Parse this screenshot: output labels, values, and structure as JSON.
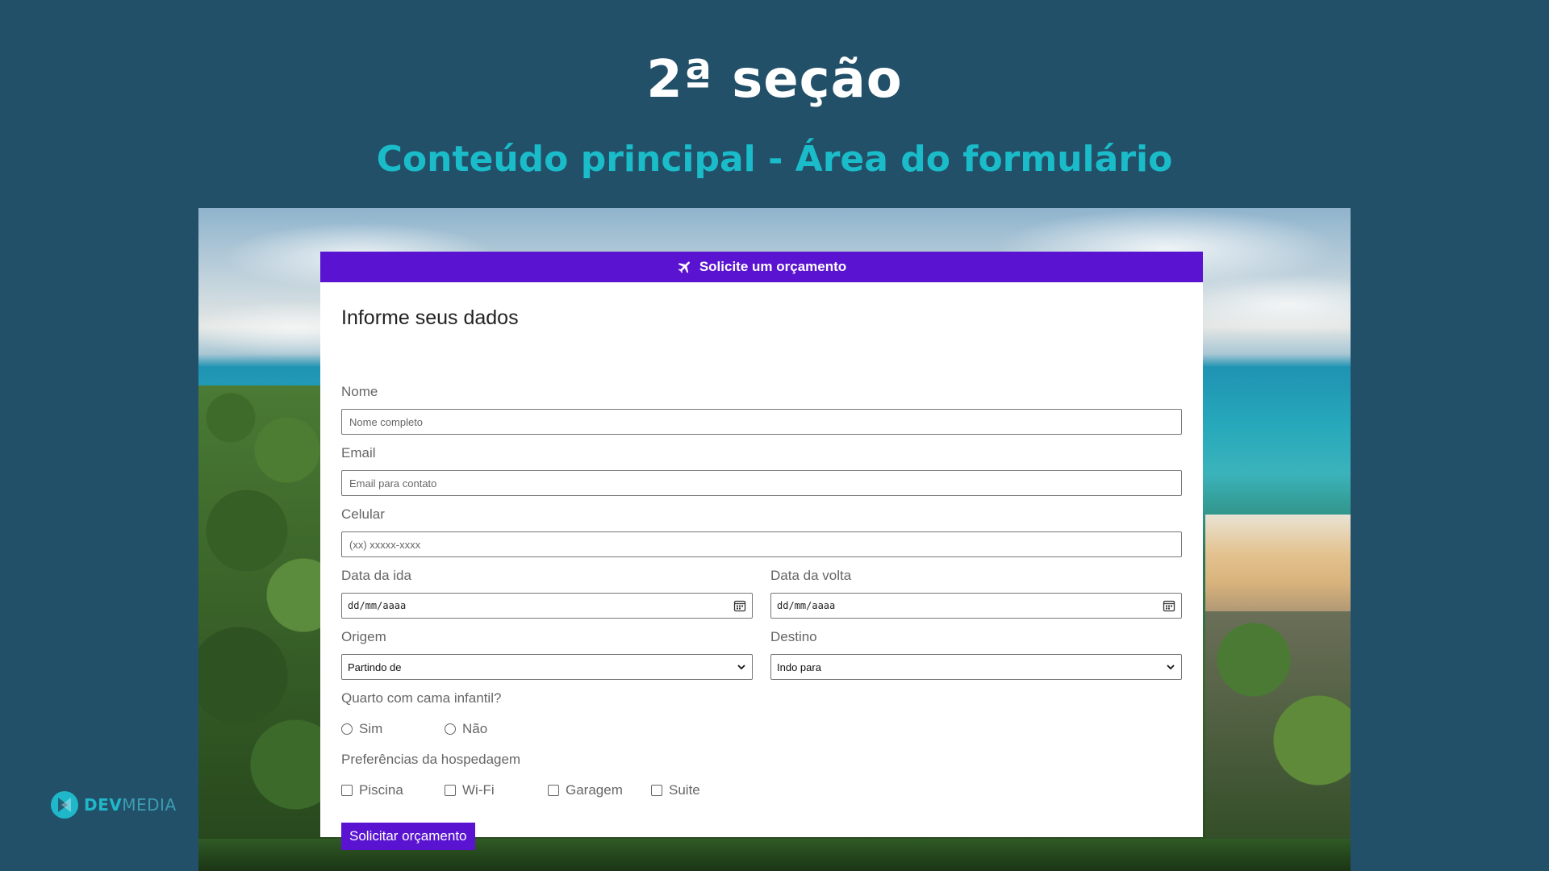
{
  "slide": {
    "title": "2ª seção",
    "subtitle": "Conteúdo principal - Área do formulário"
  },
  "card": {
    "header_icon": "airplane-icon",
    "header_title": "Solicite um orçamento",
    "heading": "Informe seus dados"
  },
  "form": {
    "nome": {
      "label": "Nome",
      "placeholder": "Nome completo"
    },
    "email": {
      "label": "Email",
      "placeholder": "Email para contato"
    },
    "celular": {
      "label": "Celular",
      "placeholder": "(xx) xxxxx-xxxx"
    },
    "data_ida": {
      "label": "Data da ida",
      "value": "dd/mm/aaaa"
    },
    "data_volta": {
      "label": "Data da volta",
      "value": "dd/mm/aaaa"
    },
    "origem": {
      "label": "Origem",
      "value": "Partindo de"
    },
    "destino": {
      "label": "Destino",
      "value": "Indo para"
    },
    "cama_infantil": {
      "label": "Quarto com cama infantil?",
      "options": [
        "Sim",
        "Não"
      ]
    },
    "preferencias": {
      "label": "Preferências da hospedagem",
      "options": [
        "Piscina",
        "Wi-Fi",
        "Garagem",
        "Suite"
      ]
    },
    "submit_label": "Solicitar orçamento"
  },
  "logo": {
    "brand_bold": "DEV",
    "brand_light": "MEDIA"
  },
  "colors": {
    "background": "#225069",
    "accent_purple": "#5a14d1",
    "subtitle_teal": "#1bbcc9"
  }
}
